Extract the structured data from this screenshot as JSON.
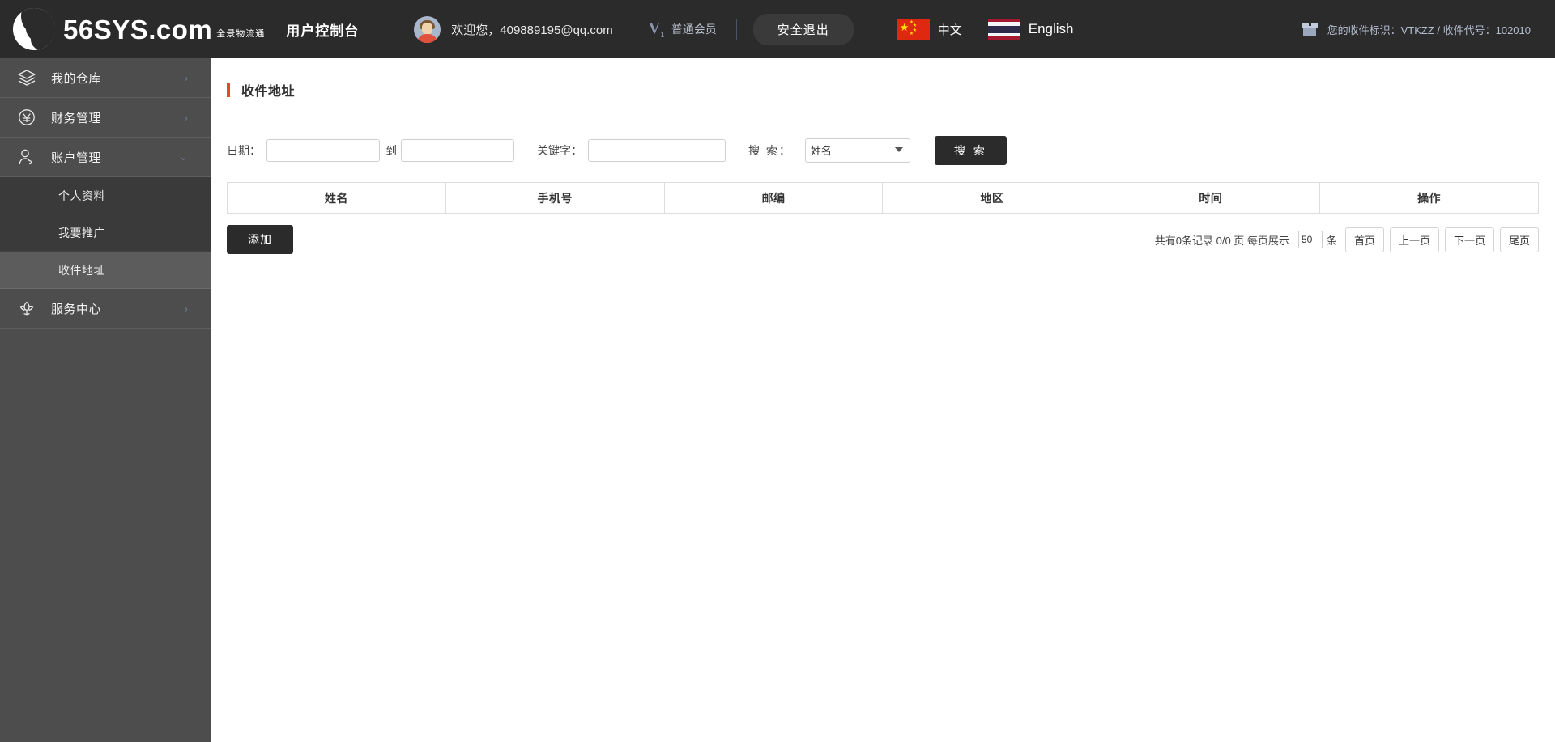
{
  "topbar": {
    "brand_name": "56SYS.com",
    "brand_sub": "全景物流通",
    "console_title": "用户控制台",
    "avatar_icon": "user-avatar-icon",
    "welcome": "欢迎您，409889195@qq.com",
    "vip_mark": "V",
    "vip_mark_sub": "1",
    "vip_text": "普通会员",
    "logout_label": "安全退出",
    "lang_cn": "中文",
    "lang_en": "English",
    "flag_cn_icon": "china-flag-icon",
    "flag_th_icon": "thailand-flag-icon",
    "box_icon": "package-box-icon",
    "receiver_info": "您的收件标识：VTKZZ / 收件代号：102010"
  },
  "sidebar": {
    "items": [
      {
        "label": "我的仓库",
        "icon": "layers-icon",
        "arrow": "›",
        "expanded": false
      },
      {
        "label": "财务管理",
        "icon": "yen-circle-icon",
        "arrow": "›",
        "expanded": false
      },
      {
        "label": "账户管理",
        "icon": "user-account-icon",
        "arrow": "⌄",
        "expanded": true
      },
      {
        "label": "服务中心",
        "icon": "lotus-icon",
        "arrow": "›",
        "expanded": false
      }
    ],
    "submenu": [
      {
        "label": "个人资料",
        "active": false
      },
      {
        "label": "我要推广",
        "active": false
      },
      {
        "label": "收件地址",
        "active": true
      }
    ]
  },
  "page": {
    "title": "收件地址",
    "accent_color": "#e8491d"
  },
  "filter": {
    "date_label": "日期：",
    "date_from_value": "",
    "date_from_placeholder": "",
    "to_label": "到",
    "date_to_value": "",
    "date_to_placeholder": "",
    "keyword_label": "关键字：",
    "keyword_value": "",
    "keyword_placeholder": "",
    "search_field_label": "搜 索：",
    "search_field_selected": "姓名",
    "search_field_options": [
      "姓名"
    ],
    "search_button": "搜 索"
  },
  "table": {
    "columns": [
      "姓名",
      "手机号",
      "邮编",
      "地区",
      "时间",
      "操作"
    ],
    "rows": []
  },
  "actions": {
    "add_label": "添加"
  },
  "pagination": {
    "summary": "共有0条记录  0/0 页  每页展示",
    "page_size": "50",
    "unit": "条",
    "first": "首页",
    "prev": "上一页",
    "next": "下一页",
    "last": "尾页"
  }
}
